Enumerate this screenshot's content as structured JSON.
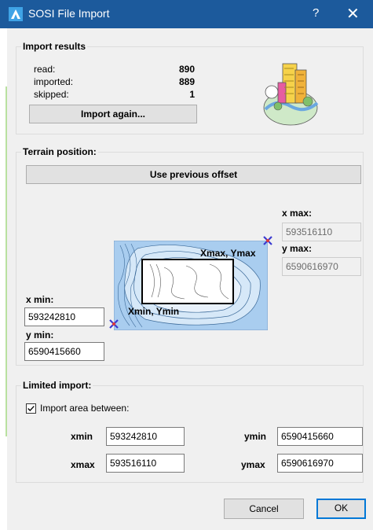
{
  "window": {
    "title": "SOSI File Import",
    "help_label": "?",
    "close_label": "✕"
  },
  "import_results": {
    "legend": "Import results",
    "read_label": "read:",
    "read_value": "890",
    "imported_label": "imported:",
    "imported_value": "889",
    "skipped_label": "skipped:",
    "skipped_value": "1",
    "import_again_label": "Import again..."
  },
  "terrain": {
    "legend": "Terrain position:",
    "use_previous_label": "Use previous offset",
    "xmax_label": "x max:",
    "xmax_value": "593516110",
    "ymax_label": "y max:",
    "ymax_value": "6590616970",
    "xmin_label": "x min:",
    "xmin_value": "593242810",
    "ymin_label": "y min:",
    "ymin_value": "6590415660",
    "map_max_label": "Xmax, Ymax",
    "map_min_label": "Xmin, Ymin"
  },
  "limited": {
    "legend": "Limited import:",
    "checkbox_label": "Import area between:",
    "checked": true,
    "xmin_label": "xmin",
    "xmin_value": "593242810",
    "ymin_label": "ymin",
    "ymin_value": "6590415660",
    "xmax_label": "xmax",
    "xmax_value": "593516110",
    "ymax_label": "ymax",
    "ymax_value": "6590616970"
  },
  "footer": {
    "cancel_label": "Cancel",
    "ok_label": "OK"
  },
  "colors": {
    "titlebar": "#1c5a9c",
    "dialog_bg": "#f0f0f0",
    "map_water": "#a9cdef",
    "marker": "#3a3ad0"
  },
  "icons": [
    "app-logo-icon",
    "help-icon",
    "close-icon",
    "city-illustration-icon",
    "checkmark-icon",
    "corner-marker-icon"
  ]
}
